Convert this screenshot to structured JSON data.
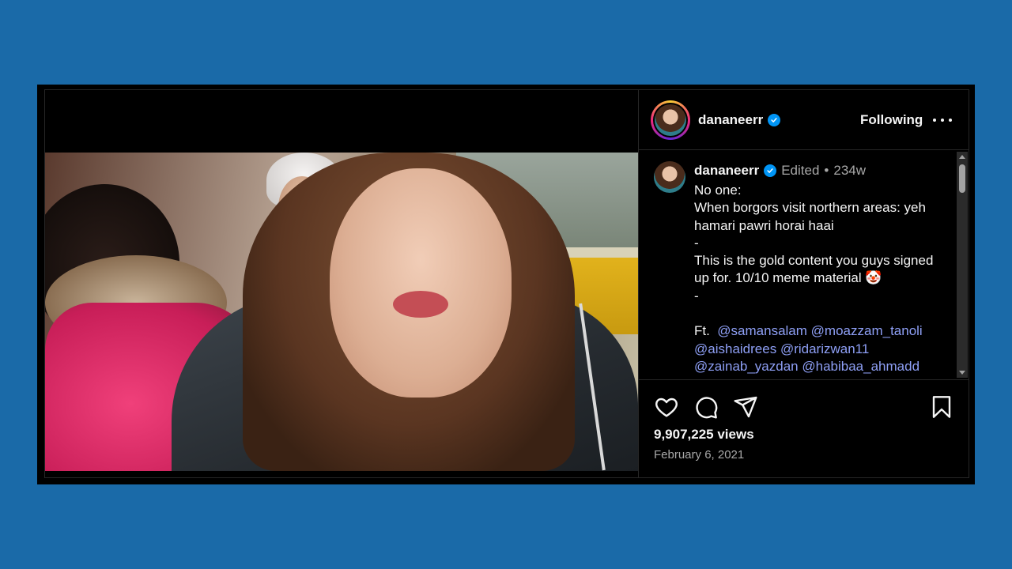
{
  "post": {
    "username": "dananeerr",
    "follow_label": "Following",
    "caption": {
      "username": "dananeerr",
      "edited": "Edited",
      "separator": "•",
      "age": "234w",
      "lines": [
        "No one:",
        "When borgors visit northern areas: yeh hamari pawri horai haai",
        "-",
        "This is the gold content you guys signed up for. 10/10 meme material 🤡",
        "-",
        ""
      ],
      "ft_label": "Ft.",
      "mentions": [
        "@samansalam",
        "@moazzam_tanoli",
        "@aishaidrees",
        "@ridarizwan11",
        "@zainab_yazdan",
        "@habibaa_ahmadd"
      ]
    },
    "views": "9,907,225 views",
    "date": "February 6, 2021"
  },
  "icons": {
    "verified": "verified-badge-icon",
    "more": "more-options-icon",
    "like": "heart-icon",
    "comment": "comment-icon",
    "share": "share-icon",
    "save": "bookmark-icon",
    "mute": "muted-speaker-icon"
  },
  "colors": {
    "background": "#1a6aa8",
    "panel": "#000000",
    "text": "#f5f5f5",
    "muted": "#a8a8a8",
    "mention": "#8e9ff5",
    "verified": "#0095f6"
  }
}
